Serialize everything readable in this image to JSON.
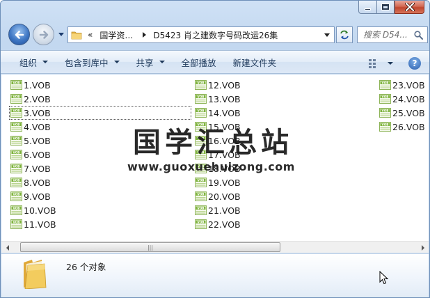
{
  "nav": {
    "back_icon": "back-arrow-icon",
    "forward_icon": "forward-arrow-icon"
  },
  "address": {
    "overflow": "«",
    "crumbs": [
      "国学资…",
      "D5423 肖之建数字号码改运26集"
    ]
  },
  "search": {
    "placeholder": "搜索 D54..."
  },
  "toolbar": {
    "organize": "组织",
    "include_library": "包含到库中",
    "share": "共享",
    "play_all": "全部播放",
    "new_folder": "新建文件夹"
  },
  "files": {
    "col1": [
      "1.VOB",
      "2.VOB",
      "3.VOB",
      "4.VOB",
      "5.VOB",
      "6.VOB",
      "7.VOB",
      "8.VOB",
      "9.VOB",
      "10.VOB",
      "11.VOB"
    ],
    "col2": [
      "12.VOB",
      "13.VOB",
      "14.VOB",
      "15.VOB",
      "16.VOB",
      "17.VOB",
      "18.VOB",
      "19.VOB",
      "20.VOB",
      "21.VOB",
      "22.VOB"
    ],
    "col3": [
      "23.VOB",
      "24.VOB",
      "25.VOB",
      "26.VOB"
    ]
  },
  "watermark": {
    "title": "国学汇总站",
    "url": "www.guoxuehuizong.com"
  },
  "status": {
    "count": "26 个对象"
  },
  "colors": {
    "window_frame": "#bcd3ee",
    "vob_icon": "#7db33b",
    "folder": "#f2c94c"
  }
}
